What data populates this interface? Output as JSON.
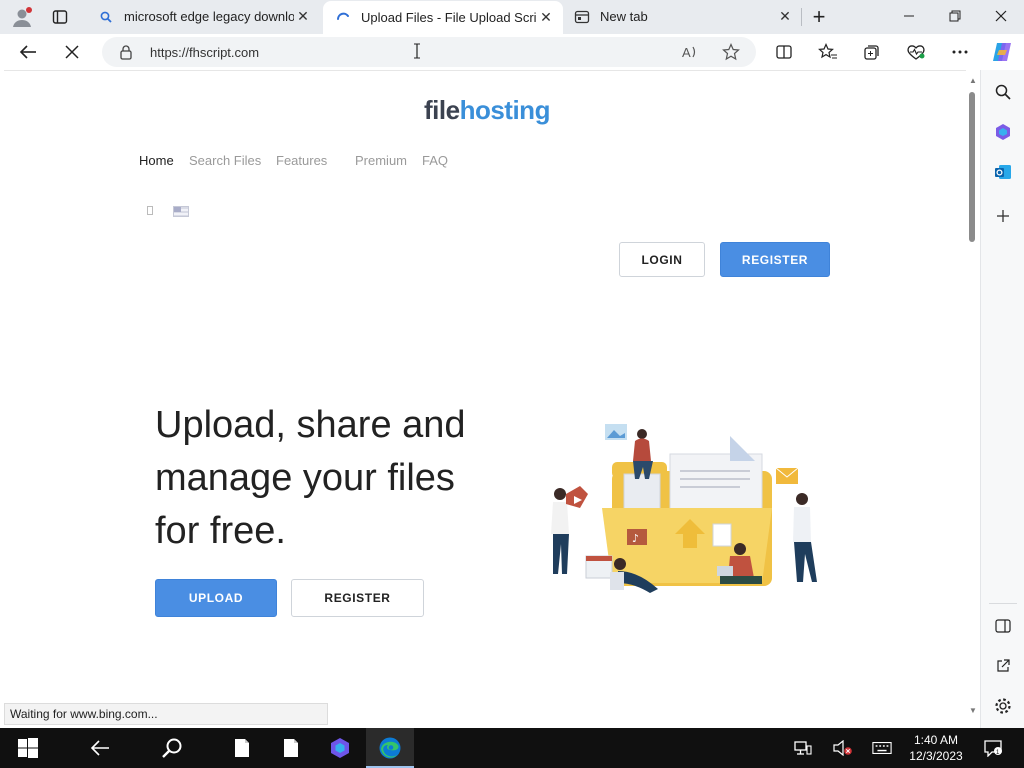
{
  "browser": {
    "tabs": [
      {
        "title": "microsoft edge legacy downloa",
        "icon": "search-icon",
        "active": false
      },
      {
        "title": "Upload Files - File Upload Script",
        "icon": "loading-icon",
        "active": true
      },
      {
        "title": "New tab",
        "icon": "new-tab-icon",
        "active": false
      }
    ],
    "tab_close_glyph": "✕",
    "new_tab_glyph": "+",
    "address": "https://fhscript.com",
    "status_text": "Waiting for www.bing.com..."
  },
  "site": {
    "logo_part1": "file",
    "logo_part2": "hosting",
    "nav": {
      "home": "Home",
      "search": "Search Files",
      "features": "Features",
      "premium": "Premium",
      "faq": "FAQ"
    },
    "login_label": "LOGIN",
    "register_label": "REGISTER",
    "hero_line1": "Upload, share and",
    "hero_line2": "manage your files",
    "hero_line3": "for free.",
    "upload_label": "UPLOAD",
    "hero_register_label": "REGISTER"
  },
  "taskbar": {
    "time": "1:40 AM",
    "date": "12/3/2023"
  },
  "colors": {
    "accent": "#4a8ee3",
    "logo_dark": "#3b4250",
    "logo_blue": "#3a8fd9",
    "folder": "#f3c94d"
  }
}
